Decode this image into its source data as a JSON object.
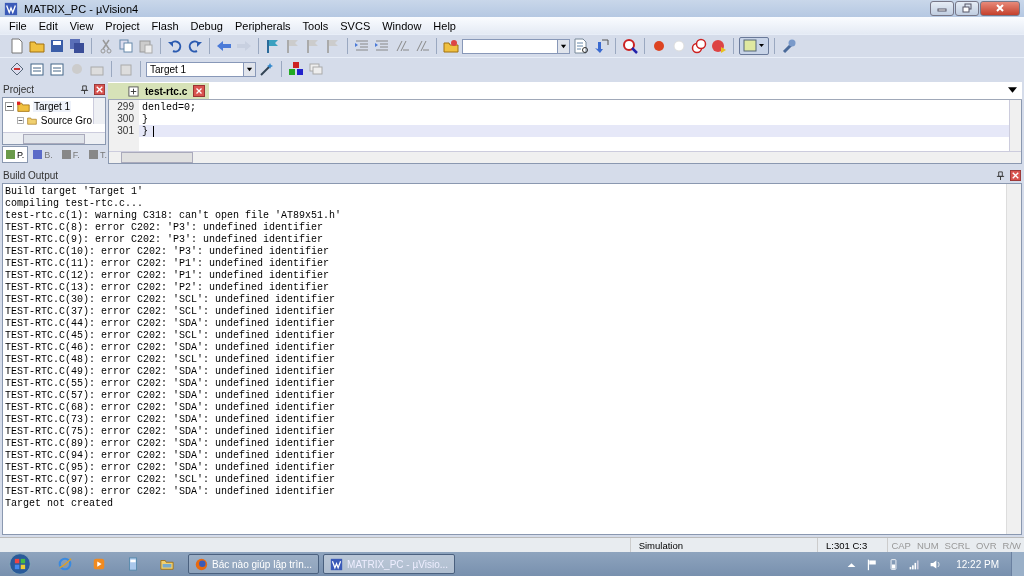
{
  "window": {
    "title": "MATRIX_PC  - µVision4"
  },
  "menu": [
    "File",
    "Edit",
    "View",
    "Project",
    "Flash",
    "Debug",
    "Peripherals",
    "Tools",
    "SVCS",
    "Window",
    "Help"
  ],
  "target_select": {
    "value": "Target 1"
  },
  "project_panel": {
    "title": "Project",
    "tree": [
      {
        "label": "Target 1",
        "expanded": true,
        "children": [
          {
            "label": "Source Gro",
            "expanded": true
          }
        ]
      }
    ],
    "tabs": [
      {
        "label": "P.",
        "selected": true
      },
      {
        "label": "B.",
        "selected": false
      },
      {
        "label": "F.",
        "selected": false
      },
      {
        "label": "T.",
        "selected": false
      }
    ]
  },
  "editor": {
    "tabs": [
      {
        "label": "test-rtc.c",
        "selected": true
      }
    ],
    "lines": [
      {
        "number": "299",
        "code": "denled=0;",
        "current": false
      },
      {
        "number": "300",
        "code": "}",
        "current": false
      },
      {
        "number": "301",
        "code": "}",
        "current": true
      }
    ]
  },
  "build_output": {
    "title": "Build Output",
    "lines": [
      "Build target 'Target 1'",
      "compiling test-rtc.c...",
      "test-rtc.c(1): warning C318: can't open file 'AT89x51.h'",
      "TEST-RTC.C(8): error C202: 'P3': undefined identifier",
      "TEST-RTC.C(9): error C202: 'P3': undefined identifier",
      "TEST-RTC.C(10): error C202: 'P3': undefined identifier",
      "TEST-RTC.C(11): error C202: 'P1': undefined identifier",
      "TEST-RTC.C(12): error C202: 'P1': undefined identifier",
      "TEST-RTC.C(13): error C202: 'P2': undefined identifier",
      "TEST-RTC.C(30): error C202: 'SCL': undefined identifier",
      "TEST-RTC.C(37): error C202: 'SCL': undefined identifier",
      "TEST-RTC.C(44): error C202: 'SDA': undefined identifier",
      "TEST-RTC.C(45): error C202: 'SCL': undefined identifier",
      "TEST-RTC.C(46): error C202: 'SDA': undefined identifier",
      "TEST-RTC.C(48): error C202: 'SCL': undefined identifier",
      "TEST-RTC.C(49): error C202: 'SDA': undefined identifier",
      "TEST-RTC.C(55): error C202: 'SDA': undefined identifier",
      "TEST-RTC.C(57): error C202: 'SDA': undefined identifier",
      "TEST-RTC.C(68): error C202: 'SDA': undefined identifier",
      "TEST-RTC.C(73): error C202: 'SDA': undefined identifier",
      "TEST-RTC.C(75): error C202: 'SDA': undefined identifier",
      "TEST-RTC.C(89): error C202: 'SDA': undefined identifier",
      "TEST-RTC.C(94): error C202: 'SDA': undefined identifier",
      "TEST-RTC.C(95): error C202: 'SDA': undefined identifier",
      "TEST-RTC.C(97): error C202: 'SCL': undefined identifier",
      "TEST-RTC.C(98): error C202: 'SDA': undefined identifier",
      "Target not created"
    ]
  },
  "status_bar": {
    "mode": "Simulation",
    "position": "L:301 C:3",
    "indicators": [
      {
        "label": "CAP",
        "on": false
      },
      {
        "label": "NUM",
        "on": false
      },
      {
        "label": "SCRL",
        "on": false
      },
      {
        "label": "OVR",
        "on": false
      },
      {
        "label": "R/W",
        "on": false
      }
    ]
  },
  "taskbar": {
    "tasks": [
      {
        "label": "Bác nào giúp lập trìn...",
        "selected": false,
        "kind": "browser"
      },
      {
        "label": "MATRIX_PC  - µVisio...",
        "selected": true,
        "kind": "uvision"
      }
    ],
    "clock": "12:22 PM"
  }
}
